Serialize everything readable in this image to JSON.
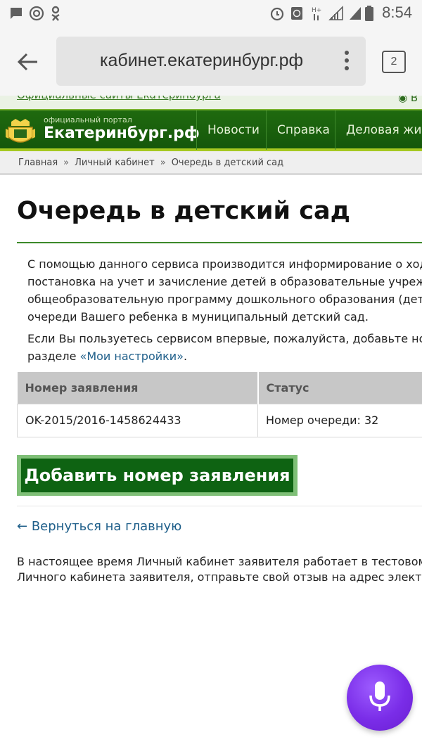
{
  "status_bar": {
    "time": "8:54",
    "icons": [
      "message-icon",
      "at-icon",
      "odnoklassniki-icon",
      "alarm-icon",
      "vpn-icon",
      "hplus-signal-icon",
      "signal-icon",
      "signal-icon-2",
      "battery-icon"
    ]
  },
  "browser": {
    "url": "кабинет.екатеринбург.рф",
    "tab_count": "2",
    "icons": [
      "back-arrow-icon",
      "more-vert-icon"
    ]
  },
  "site": {
    "top_link": "Официальные сайты Екатеринбурга",
    "top_right_partial": "В",
    "portal_small": "официальный портал",
    "portal_name": "Екатеринбург.рф",
    "nav": [
      "Новости",
      "Справка",
      "Деловая жизнь"
    ],
    "colors": {
      "header_green": "#1f6a0f",
      "accent_yellow": "#a6c821",
      "link_blue": "#1f5f8a",
      "button_green": "#0e6312"
    }
  },
  "breadcrumb": {
    "items": [
      "Главная",
      "Личный кабинет",
      "Очередь в детский сад"
    ],
    "separator": "»"
  },
  "page": {
    "title": "Очередь в детский сад",
    "intro_lines": [
      "С помощью данного сервиса производится информирование о ходе",
      "постановка на учет и зачисление детей в образовательные учреждения,",
      "общеобразовательную программу дошкольного образования (детские сады),",
      "очереди Вашего ребенка в муниципальный детский сад."
    ],
    "first_use_line1": "Если Вы пользуетесь сервисом впервые, пожалуйста, добавьте номер",
    "first_use_prefix": "разделе ",
    "settings_link": "«Мои настройки»",
    "first_use_suffix": "."
  },
  "table": {
    "headers": [
      "Номер заявления",
      "Статус"
    ],
    "rows": [
      {
        "number": "OK-2015/2016-1458624433",
        "status": "Номер очереди: 32"
      }
    ]
  },
  "add_button": {
    "label": "Добавить номер заявления"
  },
  "back_link": {
    "arrow": "←",
    "label": "Вернуться на главную"
  },
  "footer": {
    "line1": "В настоящее время Личный кабинет заявителя работает в тестовом режиме",
    "line2": "Личного кабинета заявителя, отправьте свой отзыв на адрес электронной почты"
  },
  "assistant": {
    "icon": "microphone-icon"
  }
}
